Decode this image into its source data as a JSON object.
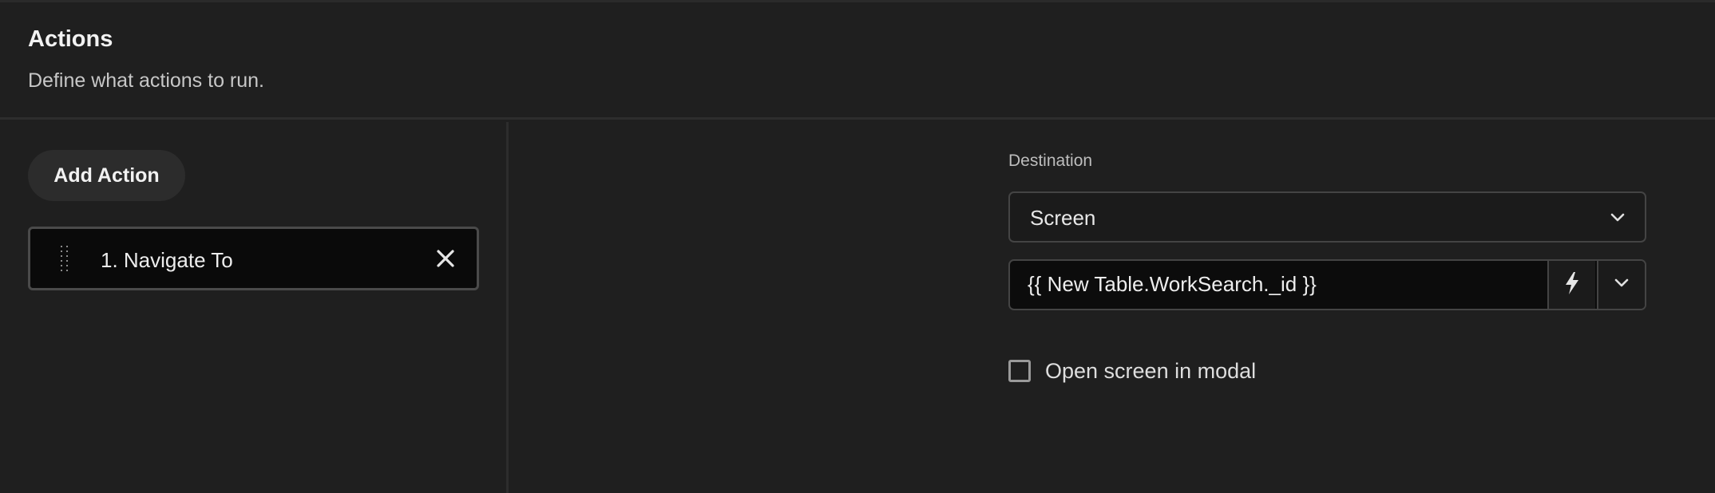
{
  "header": {
    "title": "Actions",
    "subtitle": "Define what actions to run."
  },
  "sidebar": {
    "add_action_label": "Add Action",
    "actions": [
      {
        "label": "1. Navigate To"
      }
    ]
  },
  "form": {
    "destination_label": "Destination",
    "destination_select_value": "Screen",
    "binding_value": "{{ New Table.WorkSearch._id }}",
    "open_modal_label": "Open screen in modal",
    "open_modal_checked": false
  },
  "icons": {
    "drag": "drag-handle-icon",
    "remove": "close-icon",
    "chevron": "chevron-down-icon",
    "bolt": "lightning-bolt-icon"
  },
  "colors": {
    "background": "#1f1f1f",
    "surface_dark": "#0a0a0a",
    "button_bg": "#2c2c2c",
    "border": "#444444"
  }
}
